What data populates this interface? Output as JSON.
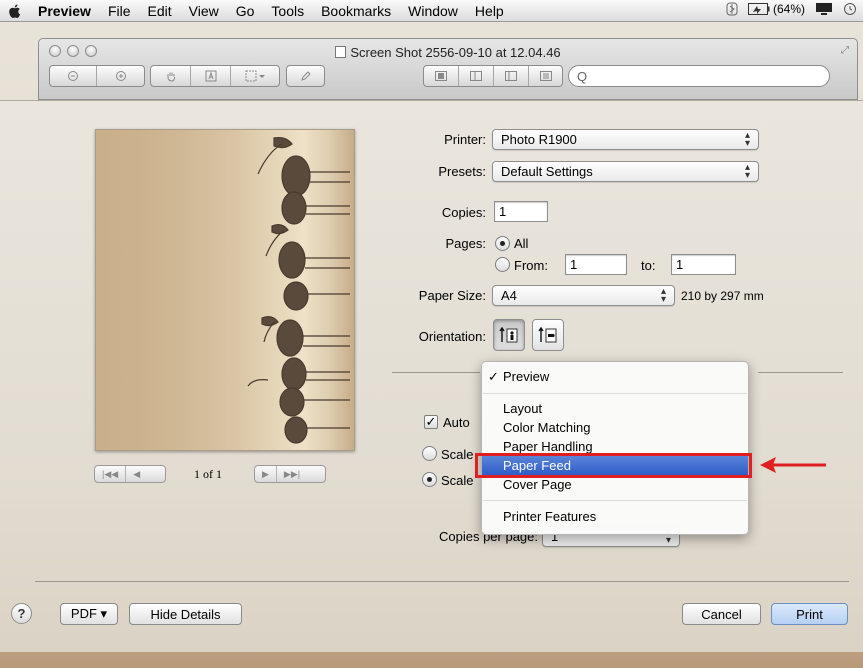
{
  "menubar": {
    "app": "Preview",
    "items": [
      "File",
      "Edit",
      "View",
      "Go",
      "Tools",
      "Bookmarks",
      "Window",
      "Help"
    ],
    "battery": "(64%)",
    "icons": [
      "apple-icon",
      "bluetooth-icon",
      "battery-icon",
      "display-icon",
      "time-machine-icon"
    ]
  },
  "window": {
    "title": "Screen Shot 2556-09-10 at 12.04.46",
    "search_placeholder": "Q"
  },
  "preview": {
    "page_count": "1 of 1",
    "nav_left": "|◀◀ | ◀",
    "nav_right": "▶ | ▶▶|"
  },
  "form": {
    "printer_label": "Printer:",
    "printer_value": "Photo R1900",
    "presets_label": "Presets:",
    "presets_value": "Default Settings",
    "copies_label": "Copies:",
    "copies_value": "1",
    "pages_label": "Pages:",
    "pages_all": "All",
    "pages_from": "From:",
    "pages_from_value": "1",
    "pages_to": "to:",
    "pages_to_value": "1",
    "paper_size_label": "Paper Size:",
    "paper_size_value": "A4",
    "paper_size_dims": "210 by 297 mm",
    "orientation_label": "Orientation:",
    "auto_label": "Auto",
    "scale_label_1": "Scale",
    "scale_label_2": "Scale",
    "copies_per_page_label": "Copies per page:",
    "copies_per_page_value": "1"
  },
  "section_menu": {
    "checked": "Preview",
    "items": [
      "Layout",
      "Color Matching",
      "Paper Handling",
      "Paper Feed",
      "Cover Page"
    ],
    "extra": "Printer Features",
    "selected": "Paper Feed"
  },
  "bottom": {
    "help": "?",
    "pdf": "PDF ▾",
    "hide_details": "Hide Details",
    "cancel": "Cancel",
    "print": "Print"
  },
  "colors": {
    "highlight": "#e02020",
    "selection": "#2e5dc9"
  }
}
